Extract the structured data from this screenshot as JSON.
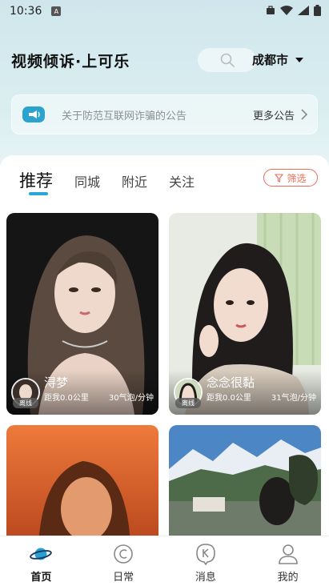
{
  "status": {
    "time": "10:36",
    "a_icon": "A"
  },
  "header": {
    "title": "视频倾诉·上可乐",
    "city": "成都市"
  },
  "notice": {
    "text": "关于防范互联网诈骗的公告",
    "more": "更多公告"
  },
  "tabs": [
    {
      "label": "推荐",
      "active": true
    },
    {
      "label": "同城"
    },
    {
      "label": "附近"
    },
    {
      "label": "关注"
    }
  ],
  "filter": {
    "label": "筛选"
  },
  "cards": [
    {
      "name": "浔梦",
      "status": "离线",
      "distance": "距我0.0公里",
      "rate": "30气泡/分钟"
    },
    {
      "name": "念念很黏",
      "status": "离线",
      "distance": "距我0.0公里",
      "rate": "31气泡/分钟"
    }
  ],
  "nav": [
    {
      "label": "首页",
      "icon": "planet-icon",
      "active": true
    },
    {
      "label": "日常",
      "icon": "circle-c-icon"
    },
    {
      "label": "消息",
      "icon": "message-k-icon"
    },
    {
      "label": "我的",
      "icon": "person-icon"
    }
  ]
}
